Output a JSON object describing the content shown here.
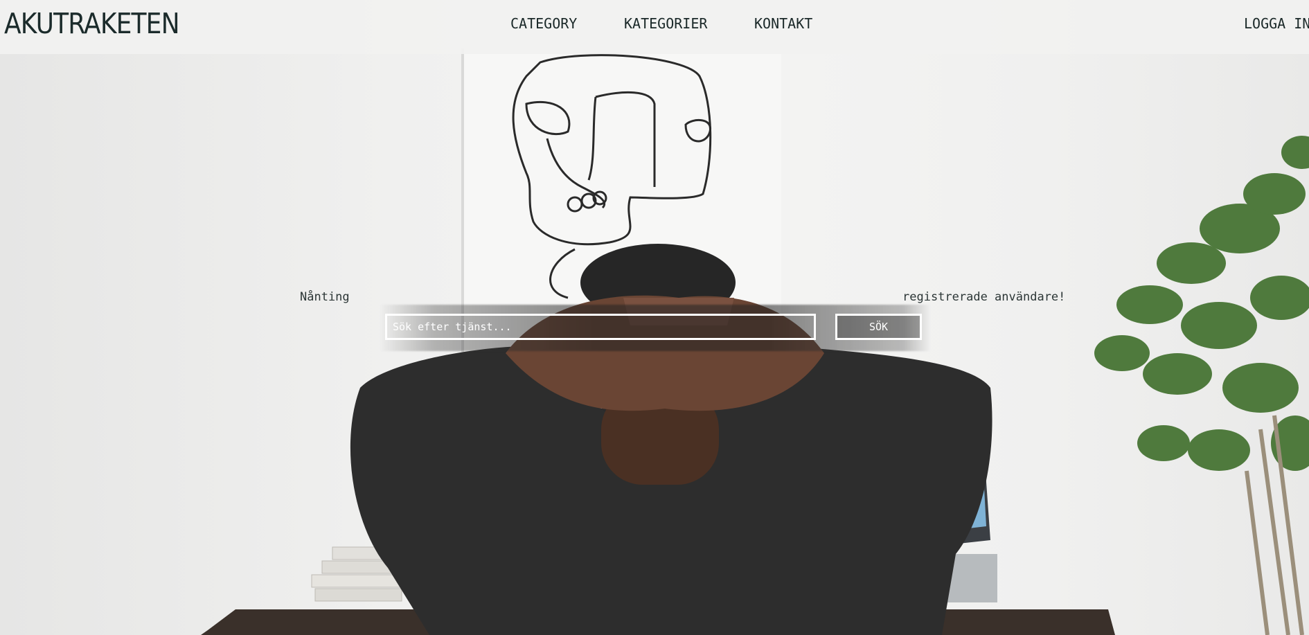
{
  "header": {
    "logo": "AKUTRAKETEN",
    "nav": {
      "category": "CATEGORY",
      "kategorier": "KATEGORIER",
      "kontakt": "KONTAKT",
      "login": "LOGGA IN"
    }
  },
  "hero": {
    "tagline_left": "Nånting",
    "tagline_right": "registrerade användare!",
    "search": {
      "placeholder": "Sök efter tjänst...",
      "value": "",
      "button_label": "SÖK"
    }
  },
  "colors": {
    "header_background": "#f1f1f0",
    "text": "#1b2b2b",
    "search_border": "#ffffff"
  }
}
